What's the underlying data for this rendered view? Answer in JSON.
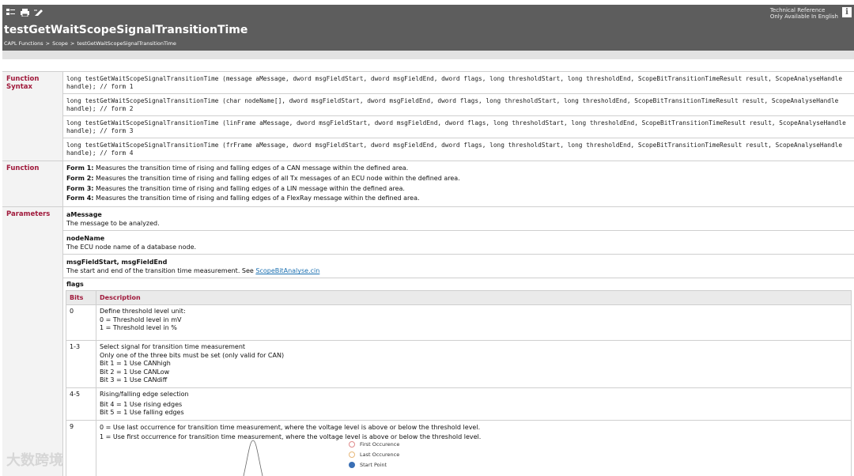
{
  "header": {
    "title": "testGetWaitScopeSignalTransitionTime",
    "tech_ref_line1": "Technical Reference",
    "tech_ref_line2": "Only Available In English",
    "info_label": "i",
    "breadcrumb": [
      "CAPL Functions",
      ">",
      "Scope",
      ">",
      "testGetWaitScopeSignalTransitionTime"
    ],
    "toolbar_icons": [
      "toc-icon",
      "print-icon",
      "edit-icon"
    ]
  },
  "syntax": {
    "label": "Function Syntax",
    "forms": [
      "long testGetWaitScopeSignalTransitionTime (message aMessage, dword msgFieldStart, dword msgFieldEnd, dword flags, long thresholdStart, long thresholdEnd, ScopeBitTransitionTimeResult result, ScopeAnalyseHandle handle); // form 1",
      "long testGetWaitScopeSignalTransitionTime (char nodeName[], dword msgFieldStart, dword msgFieldEnd, dword flags, long thresholdStart, long thresholdEnd, ScopeBitTransitionTimeResult result, ScopeAnalyseHandle handle); // form 2",
      "long testGetWaitScopeSignalTransitionTime (linFrame aMessage, dword msgFieldStart, dword msgFieldEnd, dword flags, long thresholdStart, long thresholdEnd, ScopeBitTransitionTimeResult result, ScopeAnalyseHandle handle); // form 3",
      "long testGetWaitScopeSignalTransitionTime (frFrame aMessage, dword msgFieldStart, dword msgFieldEnd, dword flags, long thresholdStart, long thresholdEnd, ScopeBitTransitionTimeResult result, ScopeAnalyseHandle handle); // form 4"
    ]
  },
  "function": {
    "label": "Function",
    "items": [
      {
        "form": "Form 1:",
        "text": "Measures the transition time of rising and falling edges of a CAN message within the defined area."
      },
      {
        "form": "Form 2:",
        "text": "Measures the transition time of rising and falling edges of all Tx messages of an ECU node within the defined area."
      },
      {
        "form": "Form 3:",
        "text": "Measures the transition time of rising and falling edges of a LIN message within the defined area."
      },
      {
        "form": "Form 4:",
        "text": "Measures the transition time of rising and falling edges of a FlexRay message within the defined area."
      }
    ]
  },
  "parameters": {
    "label": "Parameters",
    "items": [
      {
        "name": "aMessage",
        "desc": "The message to be analyzed."
      },
      {
        "name": "nodeName",
        "desc": "The ECU node name of a database node."
      },
      {
        "name": "msgFieldStart, msgFieldEnd",
        "desc": "The start and end of the transition time measurement. See ",
        "link": "ScopeBitAnalyse.cin"
      }
    ],
    "flags_title": "flags",
    "flags_headers": [
      "Bits",
      "Description"
    ],
    "flags_rows": [
      {
        "bits": "0",
        "lines": [
          "Define threshold level unit:",
          "0 = Threshold level in mV",
          "1 = Threshold level in %"
        ]
      },
      {
        "bits": "1-3",
        "lines": [
          "Select signal for transition time measurement",
          "Only one of the three bits must be set (only valid for CAN)",
          "Bit 1 = 1 Use CANhigh",
          "Bit 2 = 1 Use CANLow",
          "Bit 3 = 1 Use CANdiff"
        ]
      },
      {
        "bits": "4-5",
        "lines": [
          "Rising/falling edge selection",
          "Bit 4 = 1 Use rising edges",
          "Bit 5 = 1 Use falling edges"
        ]
      },
      {
        "bits": "9",
        "lines": [
          "0 = Use last occurrence for transition time measurement, where the voltage level is above or below the threshold level.",
          "1 = Use first occurrence for transition time measurement, where the voltage level is above or below the threshold level."
        ]
      }
    ]
  },
  "legend": {
    "items": [
      {
        "label": "First Occurence",
        "color": "#e08c8c"
      },
      {
        "label": "Last Occurence",
        "color": "#e8b87a"
      },
      {
        "label": "Start Point",
        "color": "#3a6fb5"
      }
    ]
  },
  "watermark": "大数跨境"
}
